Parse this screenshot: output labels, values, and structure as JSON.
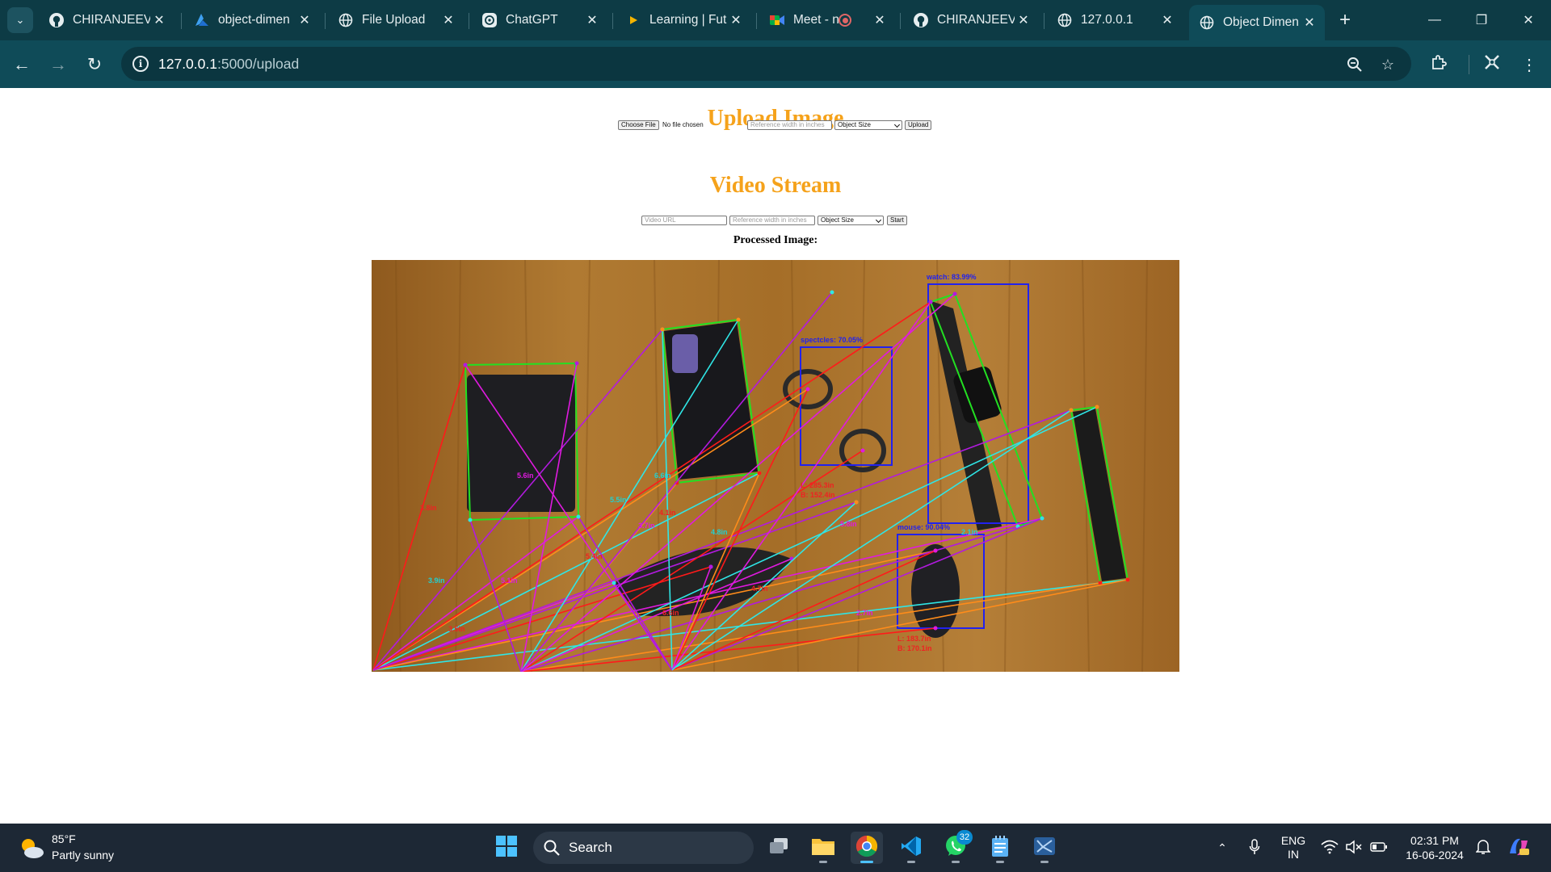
{
  "browser": {
    "tabs": [
      {
        "title": "CHIRANJEEVI",
        "icon": "github-icon"
      },
      {
        "title": "object-dimen",
        "icon": "azure-icon"
      },
      {
        "title": "File Upload",
        "icon": "globe-icon"
      },
      {
        "title": "ChatGPT",
        "icon": "chatgpt-icon"
      },
      {
        "title": "Learning | Fut",
        "icon": "play-icon"
      },
      {
        "title": "Meet - ni",
        "icon": "meet-icon"
      },
      {
        "title": "CHIRANJEEVI",
        "icon": "github-icon"
      },
      {
        "title": "127.0.0.1",
        "icon": "globe-icon"
      },
      {
        "title": "Object Dimen",
        "icon": "globe-icon"
      }
    ],
    "url_host": "127.0.0.1",
    "url_path": ":5000/upload"
  },
  "page": {
    "upload_heading": "Upload Image",
    "choose_file_label": "Choose File",
    "no_file_text": "No file chosen",
    "ref_width_placeholder": "Reference width in inches",
    "object_size_option": "Object Size",
    "upload_button": "Upload",
    "video_heading": "Video Stream",
    "video_url_placeholder": "Video URL",
    "video_ref_width_placeholder": "Reference width in inches",
    "video_object_size_option": "Object Size",
    "start_button": "Start",
    "processed_label": "Processed Image:"
  },
  "detections": {
    "watch": "watch: 83.99%",
    "spectacles": "spectcles: 70.05%",
    "mouse": "mouse: 90.04%",
    "spec_l": "L: 285.3in",
    "spec_b": "B: 152.4in",
    "mouse_l": "L: 183.7in",
    "mouse_b": "B: 170.1in",
    "distance_labels": [
      "3.8in",
      "5.6in",
      "5.5in",
      "4.1in",
      "3.7in",
      "6.6in",
      "5.4in",
      "5.1in",
      "4.8in",
      "6.6in",
      "2.7in",
      "3.9in",
      "3.5in",
      "5.8in",
      "2.1in",
      "4.7in"
    ]
  },
  "taskbar": {
    "weather_temp": "85°F",
    "weather_desc": "Partly sunny",
    "search_label": "Search",
    "whatsapp_badge": "32",
    "lang_top": "ENG",
    "lang_bottom": "IN",
    "time": "02:31 PM",
    "date": "16-06-2024"
  }
}
